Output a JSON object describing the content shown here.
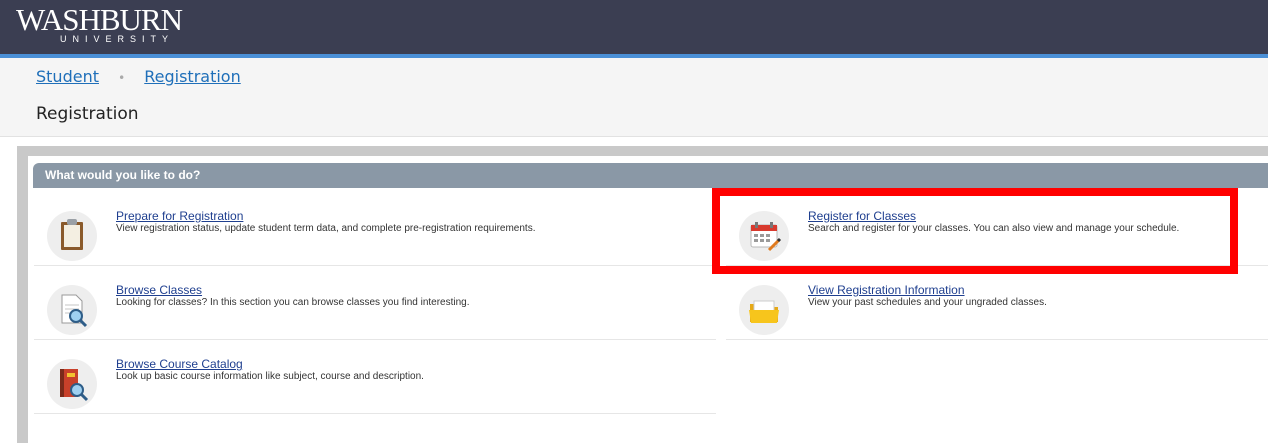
{
  "header": {
    "logo_main": "WASHBURN",
    "logo_sub": "UNIVERSITY",
    "colors": {
      "bar": "#3b3e52",
      "accent": "#4a8fd6"
    }
  },
  "breadcrumb": {
    "items": [
      {
        "label": "Student"
      },
      {
        "label": "Registration"
      }
    ],
    "separator": "•"
  },
  "page_title": "Registration",
  "panel": {
    "header": "What would you like to do?",
    "items": [
      {
        "title": "Prepare for Registration",
        "description": "View registration status, update student term data, and complete pre-registration requirements.",
        "icon": "clipboard-icon"
      },
      {
        "title": "Register for Classes",
        "description": "Search and register for your classes. You can also view and manage your schedule.",
        "icon": "calendar-icon"
      },
      {
        "title": "Browse Classes",
        "description": "Looking for classes? In this section you can browse classes you find interesting.",
        "icon": "document-search-icon"
      },
      {
        "title": "View Registration Information",
        "description": "View your past schedules and your ungraded classes.",
        "icon": "folder-icon"
      },
      {
        "title": "Browse Course Catalog",
        "description": "Look up basic course information like subject, course and description.",
        "icon": "book-search-icon"
      }
    ]
  },
  "annotation": {
    "highlight_color": "#ff0000"
  }
}
